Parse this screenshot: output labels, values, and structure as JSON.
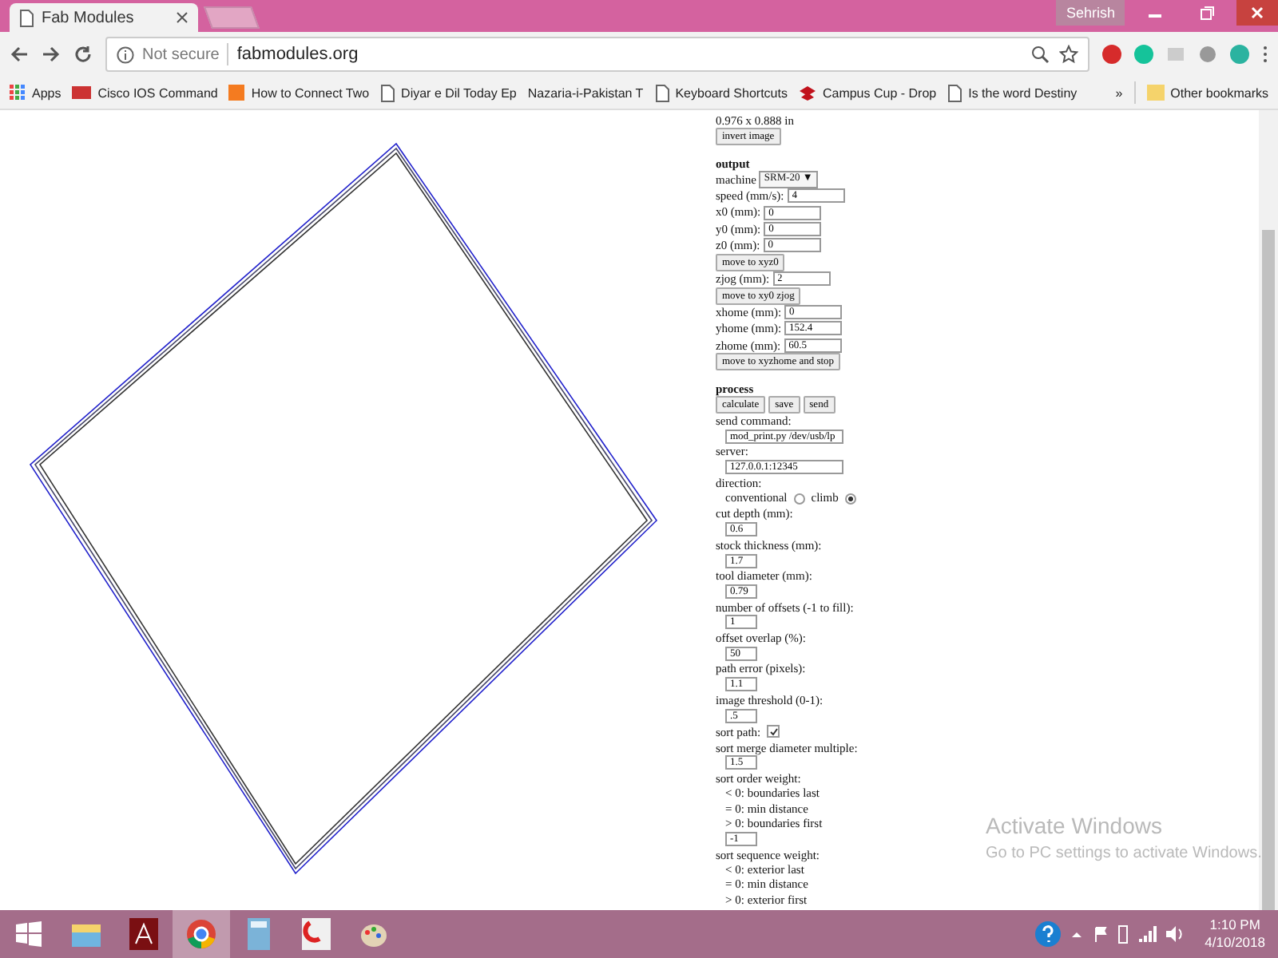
{
  "browser": {
    "tab_title": "Fab Modules",
    "user": "Sehrish",
    "security": "Not secure",
    "url": "fabmodules.org"
  },
  "bookmarks": [
    {
      "label": "Apps"
    },
    {
      "label": "Cisco IOS Command"
    },
    {
      "label": "How to Connect Two"
    },
    {
      "label": "Diyar e Dil Today Ep"
    },
    {
      "label": "Nazaria-i-Pakistan T"
    },
    {
      "label": "Keyboard Shortcuts"
    },
    {
      "label": "Campus Cup - Drop"
    },
    {
      "label": "Is the word Destiny"
    }
  ],
  "other_bookmarks": "Other bookmarks",
  "more": "»",
  "panel": [
    {
      "kind": "text",
      "text": "0.976 x 0.888 in"
    },
    {
      "kind": "button",
      "label": "invert image"
    },
    {
      "kind": "gap"
    },
    {
      "kind": "heading",
      "text": "output"
    },
    {
      "kind": "select",
      "label": "machine",
      "value": "SRM-20 ▼"
    },
    {
      "kind": "inline-field",
      "label": "speed (mm/s):",
      "value": "4"
    },
    {
      "kind": "inline-field",
      "label": "x0 (mm):",
      "value": "0"
    },
    {
      "kind": "inline-field",
      "label": "y0 (mm):",
      "value": "0"
    },
    {
      "kind": "inline-field",
      "label": "z0 (mm):",
      "value": "0"
    },
    {
      "kind": "button",
      "label": "move to xyz0"
    },
    {
      "kind": "inline-field",
      "label": "zjog (mm):",
      "value": "2"
    },
    {
      "kind": "button",
      "label": "move to xy0 zjog"
    },
    {
      "kind": "inline-field",
      "label": "xhome (mm):",
      "value": "0"
    },
    {
      "kind": "inline-field",
      "label": "yhome (mm):",
      "value": "152.4"
    },
    {
      "kind": "inline-field",
      "label": "zhome (mm):",
      "value": "60.5"
    },
    {
      "kind": "button",
      "label": "move to xyzhome and stop"
    },
    {
      "kind": "gap"
    },
    {
      "kind": "heading",
      "text": "process"
    },
    {
      "kind": "buttons",
      "labels": [
        "calculate",
        "save",
        "send"
      ]
    },
    {
      "kind": "text",
      "text": "send command:"
    },
    {
      "kind": "wide-field",
      "value": "mod_print.py /dev/usb/lp"
    },
    {
      "kind": "text",
      "text": "server:"
    },
    {
      "kind": "wide-field",
      "value": "127.0.0.1:12345"
    },
    {
      "kind": "text",
      "text": "direction:"
    },
    {
      "kind": "radios",
      "options": [
        {
          "label": "conventional",
          "selected": false
        },
        {
          "label": "climb",
          "selected": true
        }
      ]
    },
    {
      "kind": "text",
      "text": "cut depth (mm):"
    },
    {
      "kind": "field",
      "value": "0.6"
    },
    {
      "kind": "text",
      "text": "stock thickness (mm):"
    },
    {
      "kind": "field",
      "value": "1.7"
    },
    {
      "kind": "text",
      "text": "tool diameter (mm):"
    },
    {
      "kind": "field",
      "value": "0.79"
    },
    {
      "kind": "text",
      "text": "number of offsets (-1 to fill):"
    },
    {
      "kind": "field",
      "value": "1"
    },
    {
      "kind": "text",
      "text": "offset overlap (%):"
    },
    {
      "kind": "field",
      "value": "50"
    },
    {
      "kind": "text",
      "text": "path error (pixels):"
    },
    {
      "kind": "field",
      "value": "1.1"
    },
    {
      "kind": "text",
      "text": "image threshold (0-1):"
    },
    {
      "kind": "field",
      "value": ".5"
    },
    {
      "kind": "checkbox",
      "label": "sort path:",
      "checked": true
    },
    {
      "kind": "text",
      "text": "sort merge diameter multiple:"
    },
    {
      "kind": "field",
      "value": "1.5"
    },
    {
      "kind": "text",
      "text": "sort order weight:"
    },
    {
      "kind": "note",
      "text": "< 0: boundaries last"
    },
    {
      "kind": "note",
      "text": "= 0: min distance"
    },
    {
      "kind": "note",
      "text": "> 0: boundaries first"
    },
    {
      "kind": "field",
      "value": "-1"
    },
    {
      "kind": "text",
      "text": "sort sequence weight:"
    },
    {
      "kind": "note",
      "text": "< 0: exterior last"
    },
    {
      "kind": "note",
      "text": "= 0: min distance"
    },
    {
      "kind": "note",
      "text": "> 0: exterior first"
    }
  ],
  "activation": {
    "title": "Activate Windows",
    "subtitle": "Go to PC settings to activate Windows."
  },
  "taskbar": [
    {
      "selected": false
    },
    {
      "selected": false
    },
    {
      "selected": true
    },
    {
      "selected": false
    },
    {
      "selected": false
    },
    {
      "selected": false
    }
  ],
  "clock": {
    "time": "1:10 PM",
    "date": "4/10/2018"
  }
}
